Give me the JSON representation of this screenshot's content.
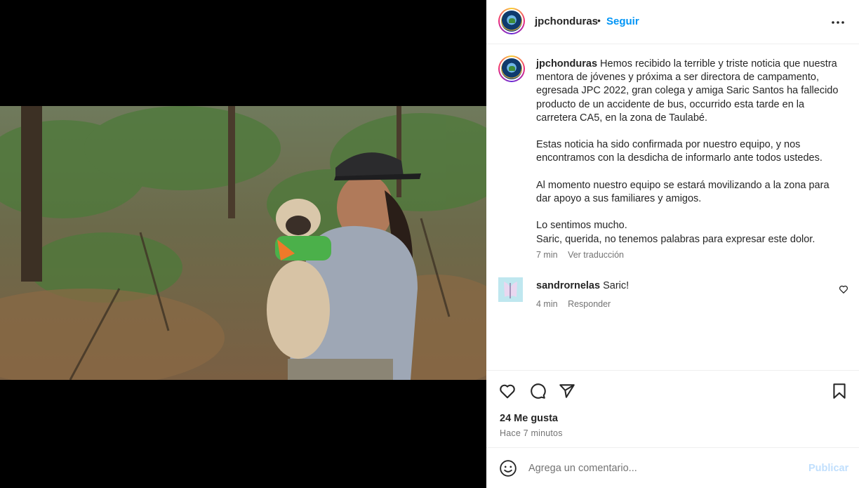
{
  "post": {
    "username": "jpchonduras",
    "separator": "•",
    "follow_label": "Seguir",
    "more_icon": "more-horizontal-icon"
  },
  "caption": {
    "username": "jpchonduras",
    "paragraphs": [
      "Hemos recibido la terrible y triste noticia que nuestra mentora de jóvenes y próxima a ser directora de campamento, egresada JPC 2022, gran colega y amiga Saric Santos ha fallecido producto de un accidente de bus, occurrido esta tarde en la carretera CA5, en la zona de Taulabé.",
      "Estas noticia ha sido confirmada por nuestro equipo, y nos encontramos con la desdicha de informarlo ante todos ustedes.",
      "Al momento nuestro equipo se estará movilizando a la zona para dar apoyo a sus familiares y amigos.",
      "Lo sentimos mucho.",
      "Saric, querida, no tenemos palabras para expresar este dolor."
    ],
    "time": "7 min",
    "translate_label": "Ver traducción"
  },
  "comment": {
    "username": "sandrornelas",
    "text": "Saric!",
    "time": "4 min",
    "reply_label": "Responder"
  },
  "actions": {
    "likes": "24 Me gusta",
    "posted_ago": "Hace 7 minutos",
    "icons": [
      "heart-icon",
      "comment-icon",
      "share-icon",
      "bookmark-icon"
    ]
  },
  "composer": {
    "placeholder": "Agrega un comentario...",
    "publish_label": "Publicar"
  },
  "colors": {
    "accent_blue": "#0095f6",
    "publish_disabled": "#c0dffd",
    "secondary_text": "#737373"
  }
}
